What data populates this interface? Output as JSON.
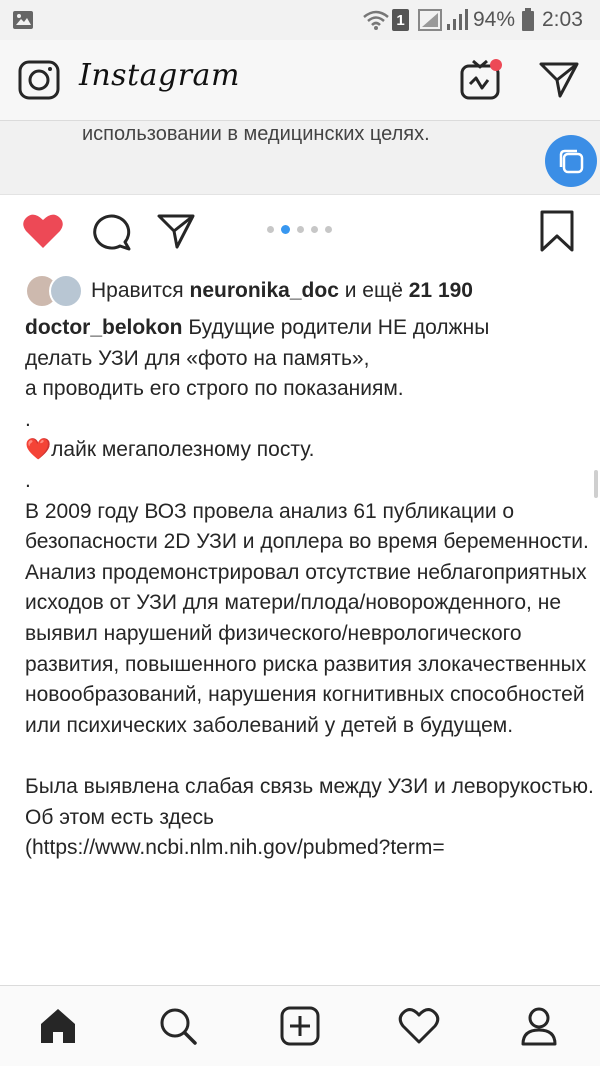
{
  "status_bar": {
    "sim_badge": "1",
    "battery": "94%",
    "time": "2:03",
    "icons": [
      "image-icon",
      "wifi-icon",
      "sim-icon",
      "signal-icon",
      "signal-bars-icon"
    ]
  },
  "header": {
    "logo": "Instagram",
    "icons": [
      "camera-icon",
      "igtv-icon",
      "direct-message-icon"
    ],
    "igtv_badge_color": "#ed4956"
  },
  "image_strip": {
    "caption": "использовании в медицинских целях."
  },
  "carousel": {
    "total": 5,
    "active_index": 1,
    "active_color": "#3897f0"
  },
  "actions": {
    "like_color": "#ed4956",
    "icons": [
      "heart-filled-icon",
      "comment-icon",
      "share-icon",
      "bookmark-icon"
    ]
  },
  "likes": {
    "prefix": "Нравится ",
    "user": "neuronika_doc",
    "middle": " и ещё ",
    "count": "21 190"
  },
  "post": {
    "username": "doctor_belokon",
    "text_first": " Будущие родители НЕ должны\nделать УЗИ для «фото на память»,\nа проводить его строго по показаниям.\n.\n",
    "heart_emoji": "❤️",
    "text_rest": "лайк мегаполезному посту.\n.\nВ 2009 году ВОЗ провела анализ 61 публикации о безопасности 2D УЗИ и доплера во время беременности.\nАнализ продемонстрировал отсутствие неблагоприятных исходов от УЗИ для матери/плода/новорожденного, не выявил нарушений физического/неврологического развития, повышенного риска развития злокачественных новообразований, нарушения когнитивных способностей или психических заболеваний у детей в будущем.\n\nБыла выявлена слабая связь между УЗИ и леворукостью.\nОб этом есть здесь\n(https://www.ncbi.nlm.nih.gov/pubmed?term="
  },
  "bottom_nav": {
    "icons": [
      "home-icon",
      "search-icon",
      "new-post-icon",
      "activity-heart-icon",
      "profile-icon"
    ]
  }
}
